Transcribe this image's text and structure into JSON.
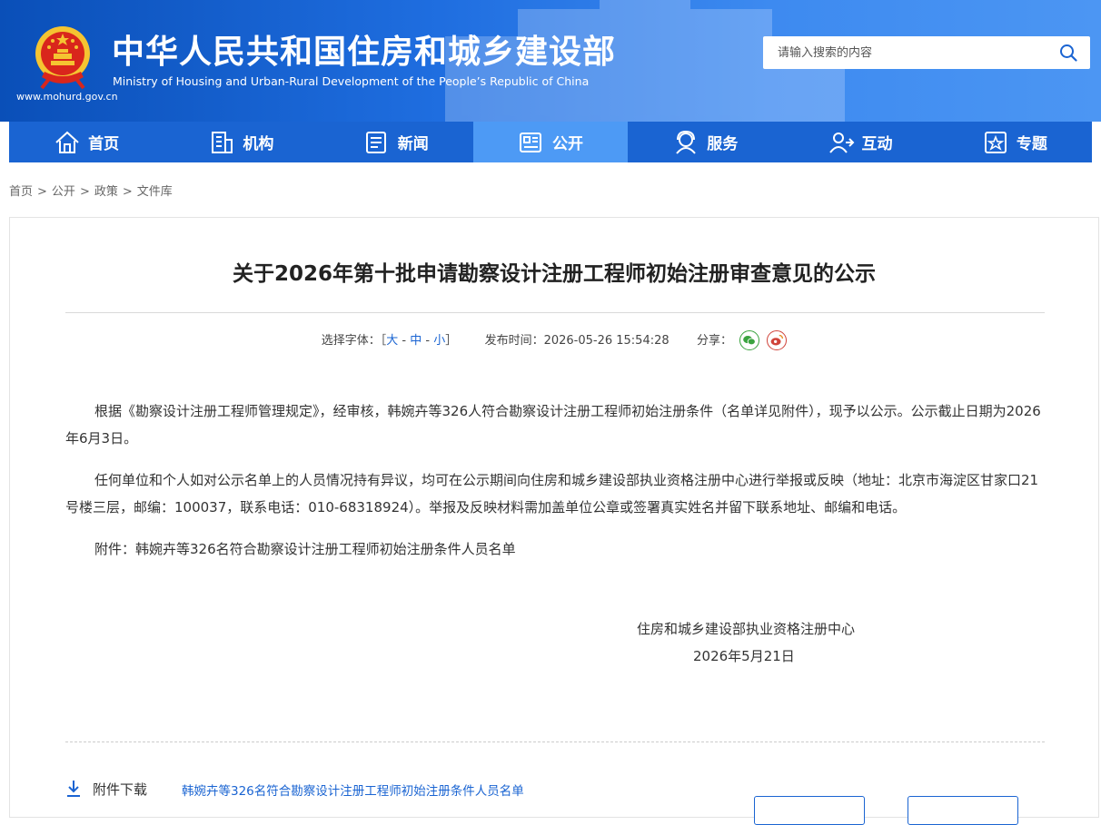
{
  "header": {
    "title_cn": "中华人民共和国住房和城乡建设部",
    "title_en": "Ministry of Housing and Urban-Rural Development of the People’s Republic of China",
    "url": "www.mohurd.gov.cn",
    "search_placeholder": "请输入搜索的内容"
  },
  "nav": {
    "items": [
      {
        "label": "首页",
        "icon": "home-icon"
      },
      {
        "label": "机构",
        "icon": "building-icon"
      },
      {
        "label": "新闻",
        "icon": "news-icon"
      },
      {
        "label": "公开",
        "icon": "disclosure-icon",
        "active": true
      },
      {
        "label": "服务",
        "icon": "service-icon"
      },
      {
        "label": "互动",
        "icon": "interaction-icon"
      },
      {
        "label": "专题",
        "icon": "topic-icon"
      }
    ]
  },
  "breadcrumb": [
    "首页",
    "公开",
    "政策",
    "文件库"
  ],
  "article": {
    "title": "关于2026年第十批申请勘察设计注册工程师初始注册审查意见的公示",
    "font_label": "选择字体：",
    "font_open": "［",
    "font_large": "大",
    "font_medium": "中",
    "font_small": "小",
    "font_dash": " - ",
    "font_close": "］",
    "publish_label": "发布时间：",
    "publish_time": "2026-05-26 15:54:28",
    "share_label": "分享：",
    "paragraphs": [
      "根据《勘察设计注册工程师管理规定》，经审核，韩婉卉等326人符合勘察设计注册工程师初始注册条件（名单详见附件），现予以公示。公示截止日期为2026年6月3日。",
      "任何单位和个人如对公示名单上的人员情况持有异议，均可在公示期间向住房和城乡建设部执业资格注册中心进行举报或反映（地址：北京市海淀区甘家口21号楼三层，邮编：100037，联系电话：010-68318924）。举报及反映材料需加盖单位公章或签署真实姓名并留下联系地址、邮编和电话。",
      "附件：韩婉卉等326名符合勘察设计注册工程师初始注册条件人员名单"
    ],
    "signature_org": "住房和城乡建设部执业资格注册中心",
    "signature_date": "2026年5月21日",
    "attachment_label": "附件下载",
    "attachment_link": "韩婉卉等326名符合勘察设计注册工程师初始注册条件人员名单"
  },
  "colors": {
    "header_blue": "#1f6ee0",
    "nav_blue": "#1a64d2",
    "nav_active": "#4d9af5",
    "link_blue": "#1a64d2"
  }
}
